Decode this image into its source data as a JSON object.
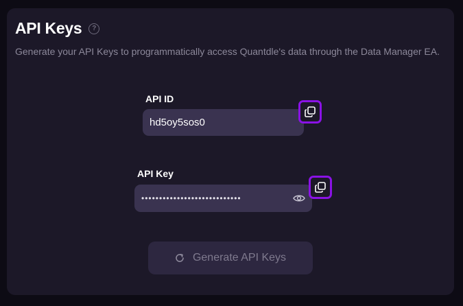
{
  "header": {
    "title": "API Keys",
    "subtitle": "Generate your API Keys to programmatically access Quantdle's data through the Data Manager EA."
  },
  "api_id": {
    "label": "API ID",
    "value": "hd5oy5sos0",
    "copy_icon": "copy-icon"
  },
  "api_key": {
    "label": "API Key",
    "masked_value": "••••••••••••••••••••••••••••",
    "reveal_icon": "eye-icon",
    "copy_icon": "copy-icon"
  },
  "generate": {
    "label": "Generate API Keys",
    "icon": "refresh-icon"
  },
  "colors": {
    "panel": "#1c1828",
    "field": "#3a3350",
    "highlight": "#8a12e6"
  }
}
